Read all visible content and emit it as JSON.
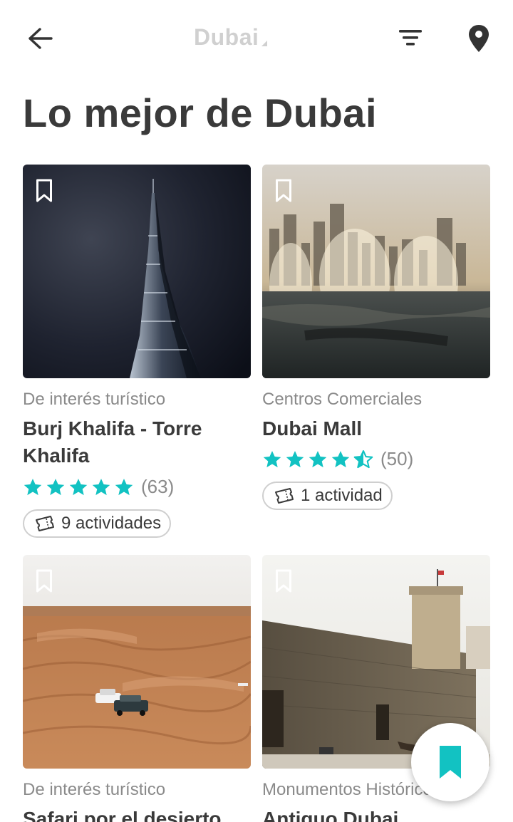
{
  "header": {
    "city": "Dubai",
    "title": "Lo mejor de Dubai"
  },
  "colors": {
    "accent": "#12c2c2",
    "star": "#12c2c2",
    "text": "#3a3a3a",
    "muted": "#8a8a8a"
  },
  "icons": {
    "back": "arrow-left-icon",
    "filter": "filter-icon",
    "map": "map-pin-icon",
    "bookmark": "bookmark-outline-icon",
    "ticket": "ticket-icon",
    "fab": "bookmark-filled-icon"
  },
  "cards": [
    {
      "category": "De interés turístico",
      "name": "Burj Khalifa - Torre Khalifa",
      "rating": 5,
      "reviews": "(63)",
      "activities": "9 actividades"
    },
    {
      "category": "Centros Comerciales",
      "name": "Dubai Mall",
      "rating": 4.5,
      "reviews": "(50)",
      "activities": "1 actividad"
    },
    {
      "category": "De interés turístico",
      "name": "Safari por el desierto"
    },
    {
      "category": "Monumentos Históricos",
      "name": "Antiguo Dubai"
    }
  ]
}
